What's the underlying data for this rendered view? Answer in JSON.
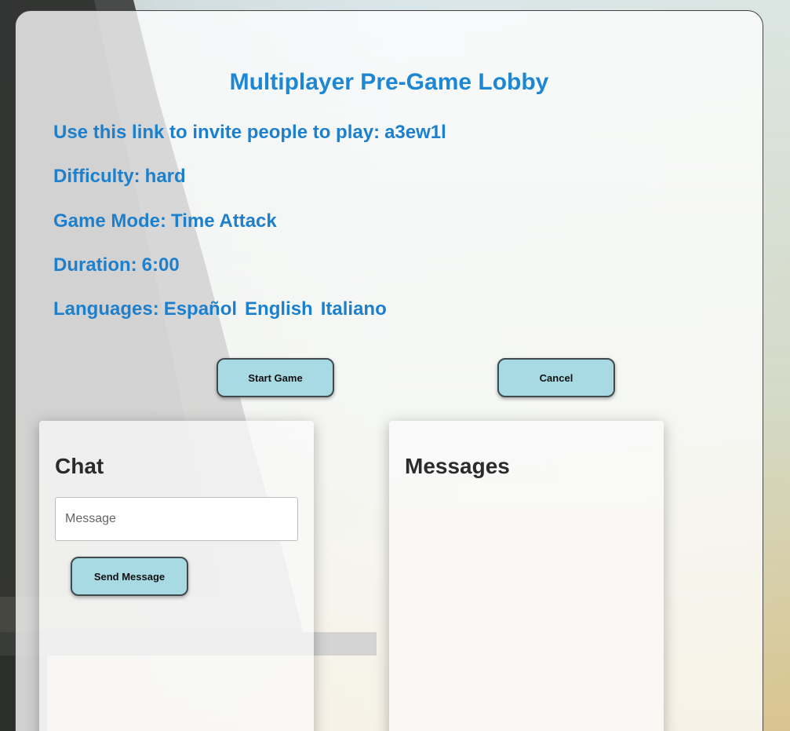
{
  "lobby": {
    "title": "Multiplayer Pre-Game Lobby",
    "invite_label": "Use this link to invite people to play:",
    "invite_code": "a3ew1l",
    "difficulty_label": "Difficulty:",
    "difficulty_value": "hard",
    "mode_label": "Game Mode:",
    "mode_value": "Time Attack",
    "duration_label": "Duration:",
    "duration_value": "6:00",
    "languages_label": "Languages:",
    "languages": [
      "Español",
      "English",
      "Italiano"
    ]
  },
  "actions": {
    "start_label": "Start Game",
    "cancel_label": "Cancel"
  },
  "chat": {
    "title": "Chat",
    "input_placeholder": "Message",
    "input_value": "",
    "send_label": "Send Message"
  },
  "messages": {
    "title": "Messages",
    "items": []
  },
  "colors": {
    "accent_text": "#1e87d4",
    "button_bg": "#a8dae4"
  }
}
